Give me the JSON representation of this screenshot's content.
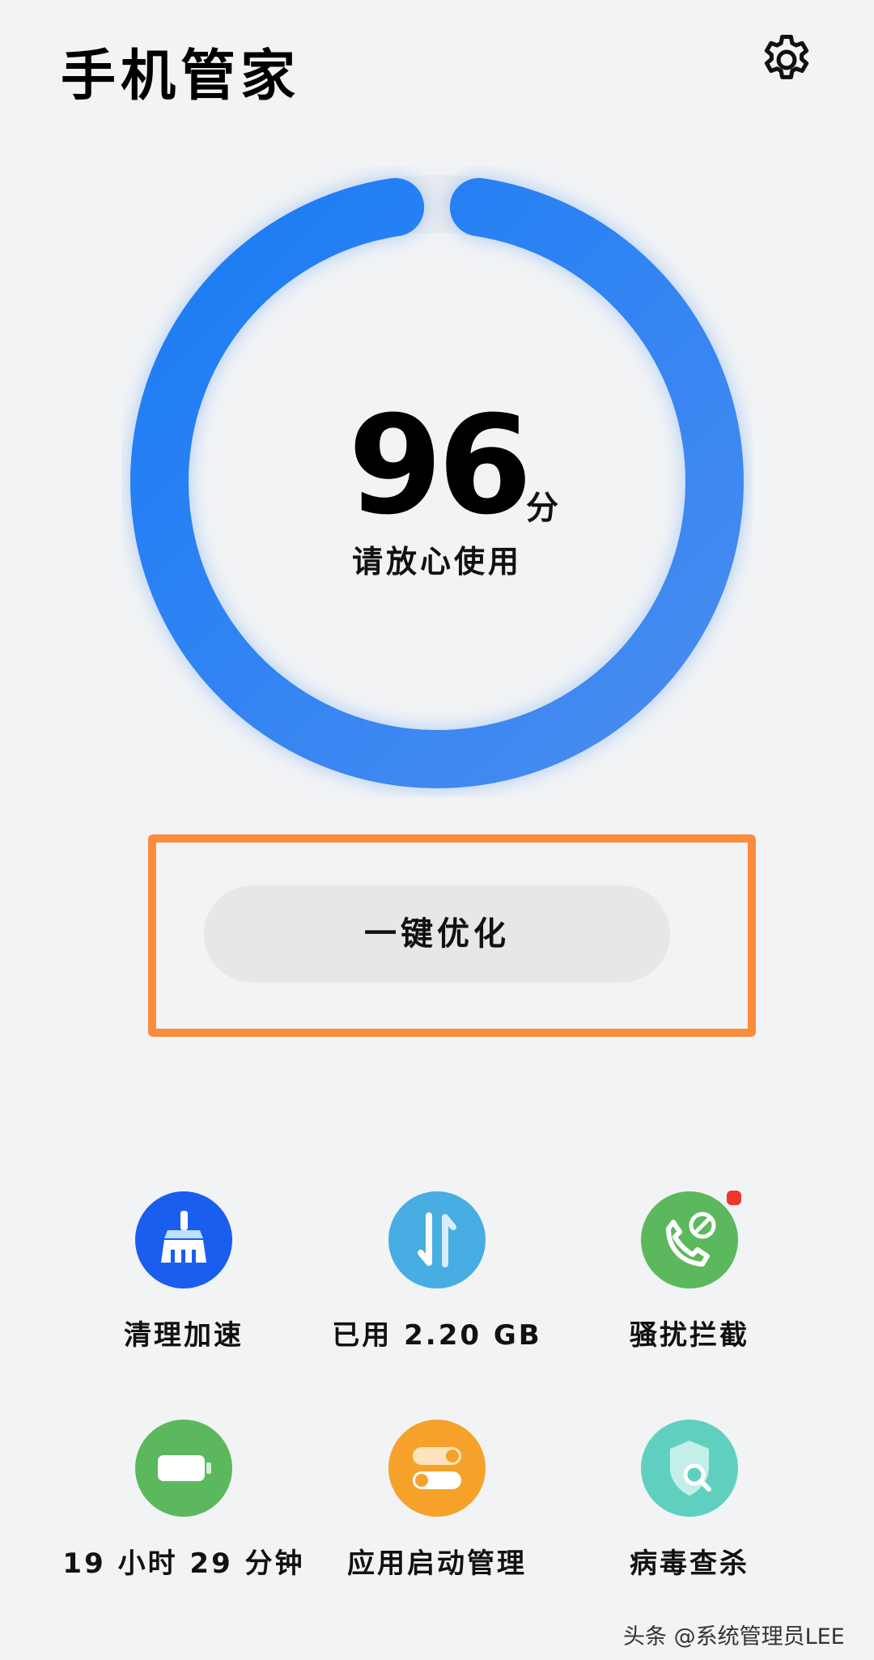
{
  "header": {
    "title": "手机管家",
    "settings_icon": "gear-icon"
  },
  "score": {
    "value": "96",
    "unit": "分",
    "description": "请放心使用",
    "progress_fraction": 0.96
  },
  "optimize": {
    "label": "一键优化"
  },
  "highlight_color": "#fb8c3c",
  "tools": [
    {
      "label": "清理加速",
      "icon": "broom-icon",
      "color": "#1a5ef0"
    },
    {
      "label": "已用 2.20 GB",
      "icon": "transfer-arrows-icon",
      "color": "#47ade2"
    },
    {
      "label": "骚扰拦截",
      "icon": "phone-block-icon",
      "color": "#5cb85c",
      "has_badge": true
    },
    {
      "label": "19 小时 29 分钟",
      "icon": "battery-icon",
      "color": "#5cb85c"
    },
    {
      "label": "应用启动管理",
      "icon": "toggle-switches-icon",
      "color": "#f6a22a"
    },
    {
      "label": "病毒查杀",
      "icon": "shield-search-icon",
      "color": "#5fd0bf"
    }
  ],
  "watermark": "头条 @系统管理员LEE"
}
